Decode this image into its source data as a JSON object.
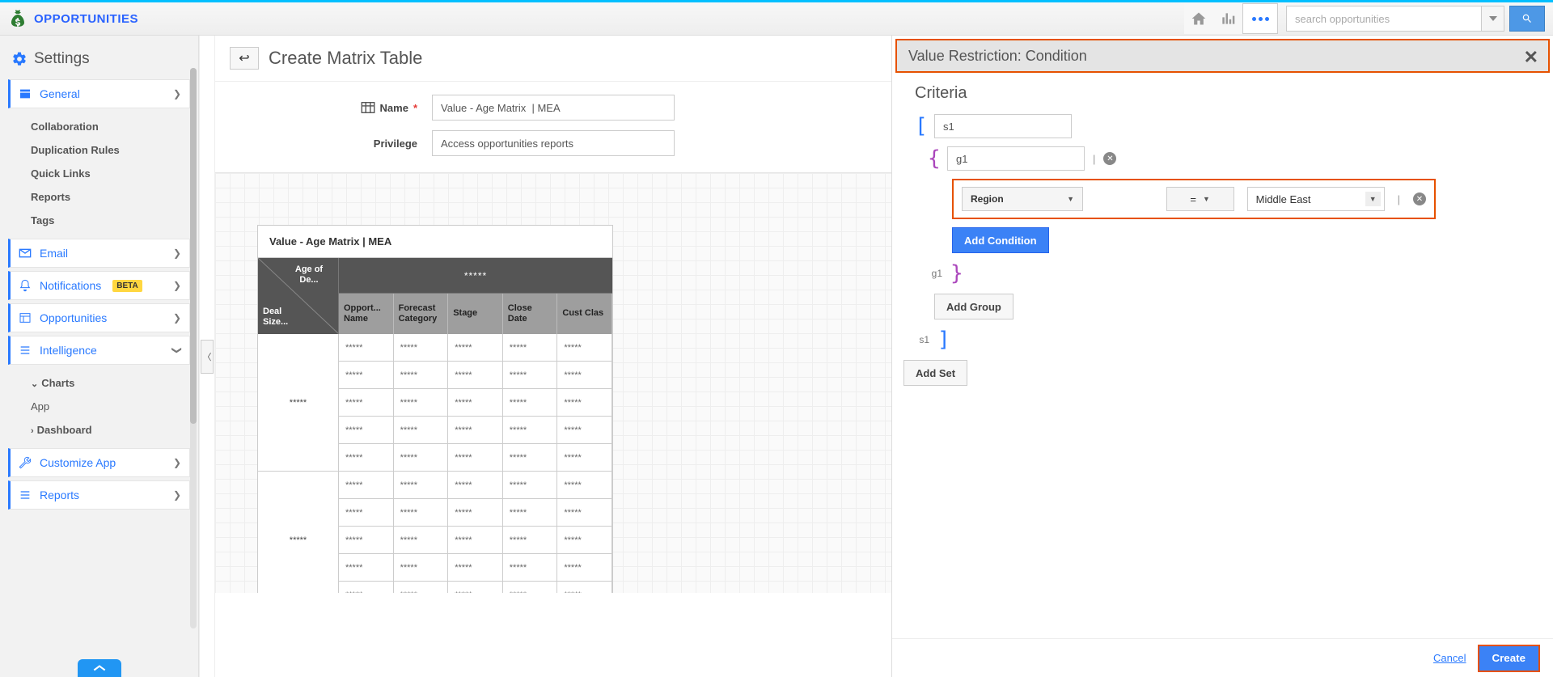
{
  "brand": {
    "title": "OPPORTUNITIES"
  },
  "topbar": {
    "search_placeholder": "search opportunities"
  },
  "sidebar": {
    "title": "Settings",
    "groups": {
      "general": {
        "label": "General",
        "items": [
          "Collaboration",
          "Duplication Rules",
          "Quick Links",
          "Reports",
          "Tags"
        ]
      },
      "email": {
        "label": "Email"
      },
      "notifications": {
        "label": "Notifications",
        "badge": "BETA"
      },
      "opportunities": {
        "label": "Opportunities"
      },
      "intelligence": {
        "label": "Intelligence",
        "children": {
          "charts": "Charts",
          "app": "App",
          "dashboard": "Dashboard"
        }
      },
      "customize": {
        "label": "Customize App"
      },
      "reports": {
        "label": "Reports"
      }
    }
  },
  "canvas": {
    "title": "Create Matrix Table",
    "name_label": "Name",
    "name_value": "Value - Age Matrix  | MEA",
    "priv_label": "Privilege",
    "priv_value": "Access opportunities reports",
    "matrix_title": "Value - Age Matrix | MEA",
    "corner_top": "Age of De...",
    "corner_bottom": "Deal Size...",
    "star_header": "*****",
    "columns": [
      "Opport...\nName",
      "Forecast Category",
      "Stage",
      "Close Date",
      "Cust\nClas"
    ],
    "row_groups": [
      "*****",
      "*****"
    ],
    "cell": "*****"
  },
  "panel": {
    "title": "Value Restriction: Condition",
    "criteria_title": "Criteria",
    "set_value": "s1",
    "group_value": "g1",
    "group_label_close": "g1",
    "set_label_close": "s1",
    "condition": {
      "field": "Region",
      "operator": "=",
      "value": "Middle East"
    },
    "add_condition": "Add Condition",
    "add_group": "Add Group",
    "add_set": "Add Set",
    "cancel": "Cancel",
    "create": "Create"
  }
}
